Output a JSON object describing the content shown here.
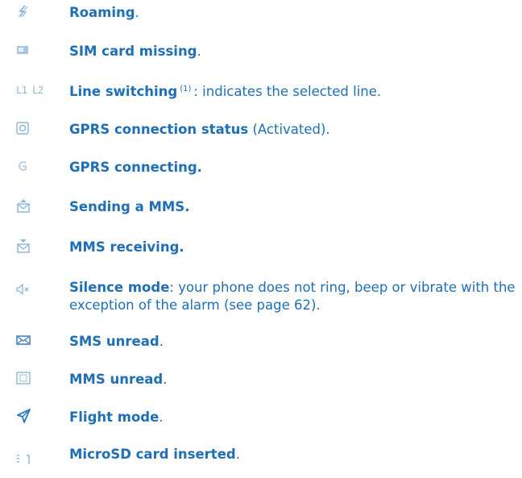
{
  "colors": {
    "text": "#1f6fb6",
    "icon": "#8fb6d6"
  },
  "items": [
    {
      "icon": "roaming-icon",
      "bold": "Roaming",
      "rest": "."
    },
    {
      "icon": "sim-missing-icon",
      "bold": "SIM card missing",
      "rest": "."
    },
    {
      "icon": "line-switch-icon",
      "icon_text": "L1 L2",
      "bold": "Line switching",
      "sup": "(1)",
      "rest": ": indicates the selected line."
    },
    {
      "icon": "gprs-status-icon",
      "bold": "GPRS connection status",
      "rest": " (Activated)."
    },
    {
      "icon": "gprs-connecting-icon",
      "bold": "GPRS connecting.",
      "rest": ""
    },
    {
      "icon": "mms-sending-icon",
      "bold": "Sending a MMS.",
      "rest": ""
    },
    {
      "icon": "mms-receiving-icon",
      "bold": "MMS receiving.",
      "rest": ""
    },
    {
      "icon": "silence-mode-icon",
      "bold": "Silence mode",
      "rest": ": your phone does not ring, beep or vibrate with the exception of the alarm (see page 62)."
    },
    {
      "icon": "sms-unread-icon",
      "bold": "SMS unread",
      "rest": "."
    },
    {
      "icon": "mms-unread-icon",
      "bold": "MMS unread",
      "rest": "."
    },
    {
      "icon": "flight-mode-icon",
      "bold": "Flight mode",
      "rest": "."
    },
    {
      "icon": "microsd-icon",
      "bold": "MicroSD card inserted",
      "rest": "."
    }
  ]
}
